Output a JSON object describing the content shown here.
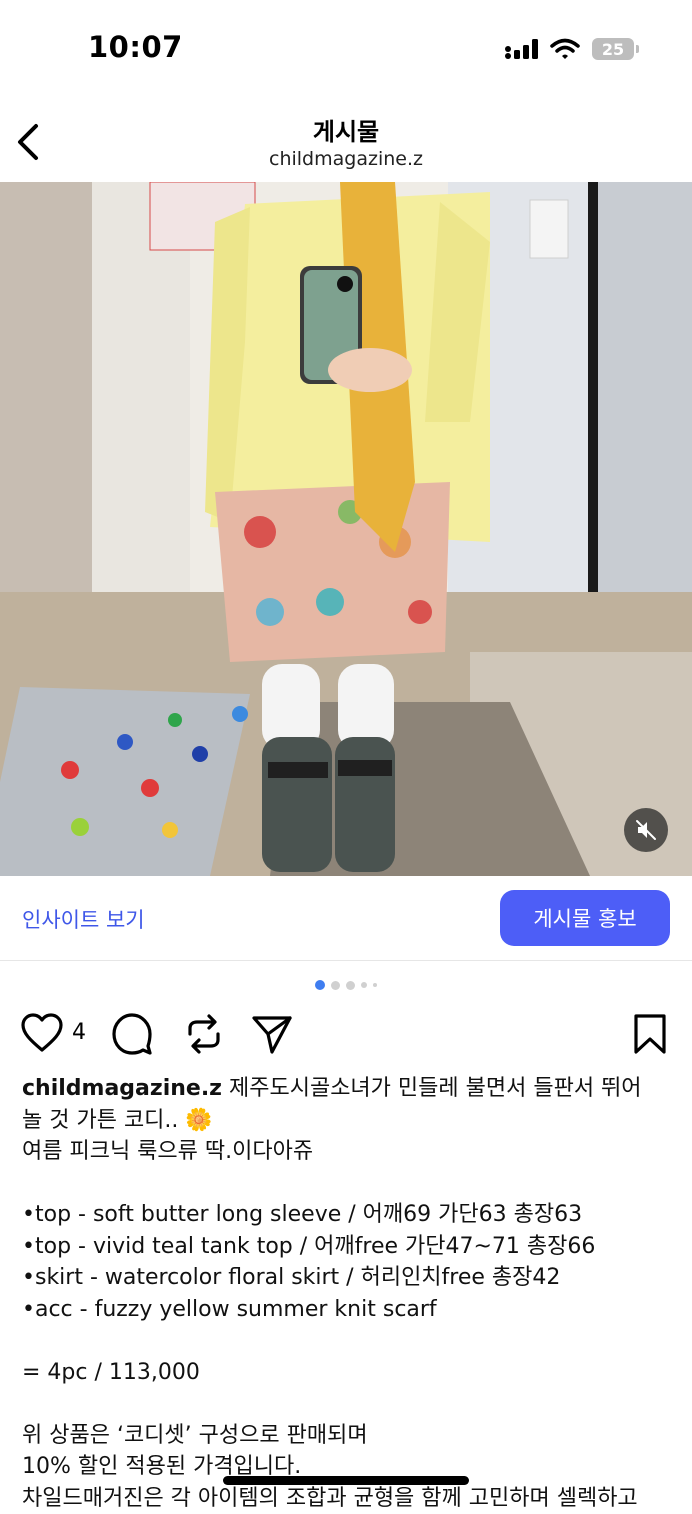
{
  "status_bar": {
    "time": "10:07",
    "battery": "25"
  },
  "header": {
    "title": "게시물",
    "username": "childmagazine.z"
  },
  "post": {
    "insights_label": "인사이트 보기",
    "promote_label": "게시물 홍보",
    "carousel": {
      "total_indicators": 5,
      "active_index": 0
    },
    "likes": "4"
  },
  "caption": {
    "username": "childmagazine.z",
    "first_line": " 제주도시골소녀가 민들레 불면서 들판서 뛰어",
    "line2": "놀 것 가튼 코디.. 🌼",
    "line3": "여름 피크닉 룩으류 딱.이다아쥬",
    "item1": "•top -  soft butter long sleeve / 어깨69 가단63 총장63",
    "item2": "•top - vivid teal tank top / 어깨free 가단47~71 총장66",
    "item3": "•skirt - watercolor floral skirt / 허리인치free 총장42",
    "item4": "•acc -  fuzzy yellow summer knit scarf",
    "price": "= 4pc / 113,000",
    "note1": "위 상품은 ‘코디셋’ 구성으로 판매되며",
    "note2": "10% 할인 적용된 가격입니다.",
    "note3": "차일드매거진은 각 아이템의 조합과 균형을 함께 고민하며 셀렉하고"
  },
  "colors": {
    "accent_blue": "#4d5ef7",
    "link_blue": "#3f57e8"
  }
}
